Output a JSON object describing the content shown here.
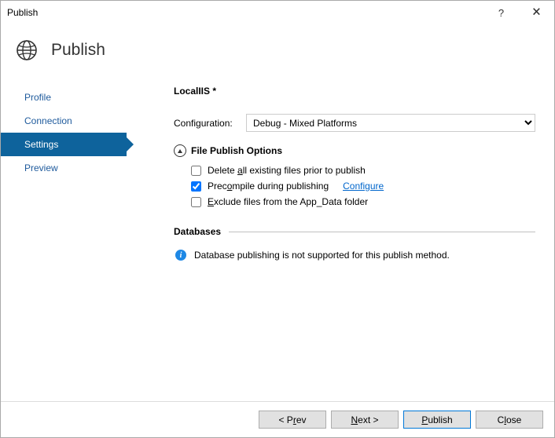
{
  "window": {
    "title": "Publish",
    "help": "?",
    "close": "🗙"
  },
  "header": {
    "title": "Publish"
  },
  "sidebar": {
    "items": [
      {
        "label": "Profile"
      },
      {
        "label": "Connection"
      },
      {
        "label": "Settings"
      },
      {
        "label": "Preview"
      }
    ]
  },
  "main": {
    "profileName": "LocalIIS *",
    "configLabel": "Configuration:",
    "configValue": "Debug - Mixed Platforms",
    "filePublishOptions": {
      "title": "File Publish Options",
      "opt1": {
        "checked": false,
        "pre": "Delete ",
        "u": "a",
        "post": "ll existing files prior to publish"
      },
      "opt2": {
        "checked": true,
        "pre": "Prec",
        "u": "o",
        "post": "mpile during publishing",
        "linkText": "Configure",
        "linkU": "C"
      },
      "opt3": {
        "checked": false,
        "pre": "",
        "u": "E",
        "post": "xclude files from the App_Data folder"
      }
    },
    "databases": {
      "title": "Databases",
      "infoText": "Database publishing is not supported for this publish method."
    }
  },
  "footer": {
    "prev": {
      "pre": "< P",
      "u": "r",
      "post": "ev"
    },
    "next": {
      "pre": "",
      "u": "N",
      "post": "ext >"
    },
    "publish": {
      "pre": "",
      "u": "P",
      "post": "ublish"
    },
    "close": {
      "pre": "C",
      "u": "l",
      "post": "ose"
    }
  }
}
